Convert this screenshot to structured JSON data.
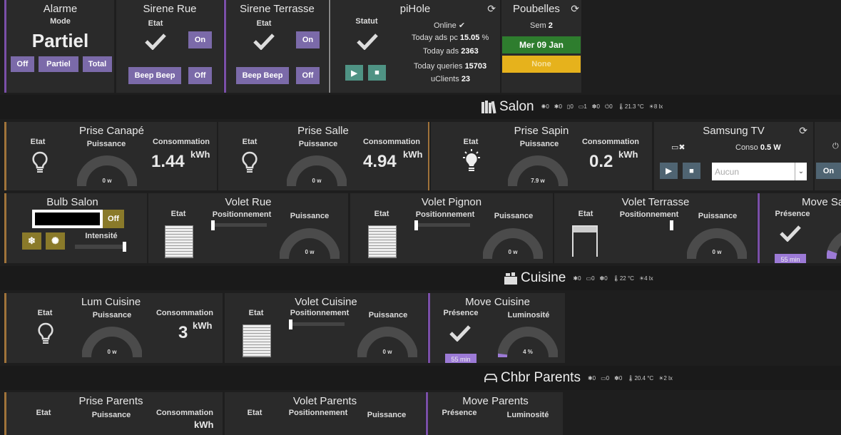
{
  "alarme": {
    "title": "Alarme",
    "mode_label": "Mode",
    "mode_value": "Partiel",
    "btn_off": "Off",
    "btn_partiel": "Partiel",
    "btn_total": "Total"
  },
  "sirene_rue": {
    "title": "Sirene Rue",
    "etat_label": "Etat",
    "btn_on": "On",
    "btn_beep": "Beep Beep",
    "btn_off": "Off"
  },
  "sirene_terrasse": {
    "title": "Sirene Terrasse",
    "etat_label": "Etat",
    "btn_on": "On",
    "btn_beep": "Beep Beep",
    "btn_off": "Off"
  },
  "pihole": {
    "title": "piHole",
    "statut_label": "Statut",
    "online": "Online",
    "ads_pc_label": "Today ads pc",
    "ads_pc_value": "15.05",
    "ads_pc_unit": "%",
    "ads_label": "Today ads",
    "ads_value": "2363",
    "queries_label": "Today queries",
    "queries_value": "15703",
    "clients_label": "uClients",
    "clients_value": "23"
  },
  "poubelles": {
    "title": "Poubelles",
    "sem_label": "Sem",
    "sem_value": "2",
    "date": "Mer 09 Jan",
    "type": "None",
    "color_date": "#2e7d2e",
    "color_type": "#e6b21c"
  },
  "rooms": {
    "salon": {
      "name": "Salon",
      "stats": [
        "0",
        "0",
        "0",
        "1",
        "0",
        "0",
        "21.3 °C",
        "8 lx"
      ]
    },
    "cuisine": {
      "name": "Cuisine",
      "stats": [
        "0",
        "0",
        "0",
        "22 °C",
        "4 lx"
      ]
    },
    "chbr": {
      "name": "Chbr Parents",
      "stats": [
        "0",
        "0",
        "0",
        "20.4 °C",
        "2 lx"
      ]
    }
  },
  "prise_canape": {
    "title": "Prise Canapé",
    "etat": "Etat",
    "puissance": "Puissance",
    "conso_label": "Consommation",
    "value": "1.44",
    "unit": "kWh",
    "gauge": "0 w"
  },
  "prise_salle": {
    "title": "Prise Salle",
    "etat": "Etat",
    "puissance": "Puissance",
    "conso_label": "Consommation",
    "value": "4.94",
    "unit": "kWh",
    "gauge": "0 w"
  },
  "prise_sapin": {
    "title": "Prise Sapin",
    "etat": "Etat",
    "puissance": "Puissance",
    "conso_label": "Consommation",
    "value": "0.2",
    "unit": "kWh",
    "gauge": "7.9 w"
  },
  "samsung_tv": {
    "title": "Samsung TV",
    "conso_label": "Conso",
    "conso_value": "0.5 W",
    "select": "Aucun"
  },
  "partial_tile": {
    "btn_on": "On"
  },
  "bulb_salon": {
    "title": "Bulb Salon",
    "btn_off": "Off",
    "intensite": "Intensité"
  },
  "volet_rue": {
    "title": "Volet Rue",
    "etat": "Etat",
    "position": "Positionnement",
    "puissance": "Puissance",
    "gauge": "0 w"
  },
  "volet_pignon": {
    "title": "Volet Pignon",
    "etat": "Etat",
    "position": "Positionnement",
    "puissance": "Puissance",
    "gauge": "0 w"
  },
  "volet_terrasse": {
    "title": "Volet Terrasse",
    "etat": "Etat",
    "position": "Positionnement",
    "puissance": "Puissance",
    "gauge": "0 w"
  },
  "move_salon": {
    "title": "Move Sa",
    "presence": "Présence",
    "badge": "55 min"
  },
  "lum_cuisine": {
    "title": "Lum Cuisine",
    "etat": "Etat",
    "puissance": "Puissance",
    "conso_label": "Consommation",
    "value": "3",
    "unit": "kWh",
    "gauge": "0 w"
  },
  "volet_cuisine": {
    "title": "Volet Cuisine",
    "etat": "Etat",
    "position": "Positionnement",
    "puissance": "Puissance",
    "gauge": "0 w"
  },
  "move_cuisine": {
    "title": "Move Cuisine",
    "presence": "Présence",
    "luminosite": "Luminosité",
    "badge": "55 min",
    "gauge": "4 %"
  },
  "prise_parents": {
    "title": "Prise Parents",
    "etat": "Etat",
    "puissance": "Puissance",
    "conso_label": "Consommation",
    "unit": "kWh"
  },
  "volet_parents": {
    "title": "Volet Parents",
    "etat": "Etat",
    "position": "Positionnement",
    "puissance": "Puissance"
  },
  "move_parents": {
    "title": "Move Parents",
    "presence": "Présence",
    "luminosite": "Luminosité"
  }
}
